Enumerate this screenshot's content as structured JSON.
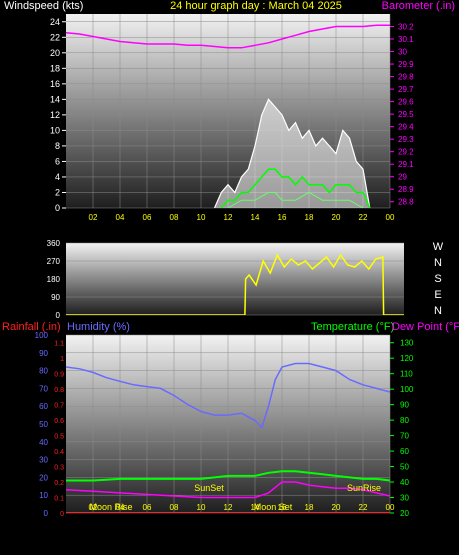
{
  "header": {
    "left_label": "Windspeed (kts)",
    "title": "24 hour graph day : March 04 2025",
    "right_label": "Barometer (.in)"
  },
  "bottom_header": {
    "rainfall_label": "Rainfall (.in)",
    "humidity_label": "Humidity (%)",
    "temperature_label": "Temperature (°F)",
    "dewpoint_label": "Dew Point (°F)"
  },
  "annotations": {
    "sunset": "SunSet",
    "sunrise": "SunRise",
    "moon_rise": "Moon Rise",
    "moon_set": "Moon Set"
  },
  "colors": {
    "white": "#ffffff",
    "yellow": "#ffff00",
    "magenta": "#ff00ff",
    "red": "#ff2020",
    "blue": "#6a6aff",
    "green": "#00ff00",
    "light_green": "#66ff66"
  },
  "chart_data": [
    {
      "id": "wind",
      "type": "line",
      "title": "24 hour graph day : March 04 2025",
      "x_ticks": [
        "02",
        "04",
        "06",
        "08",
        "10",
        "12",
        "14",
        "16",
        "18",
        "20",
        "22",
        "00"
      ],
      "x_range": [
        0,
        24
      ],
      "left_axis": {
        "label": "Windspeed (kts)",
        "ticks": [
          0,
          2,
          4,
          6,
          8,
          10,
          12,
          14,
          16,
          18,
          20,
          22,
          24
        ],
        "range": [
          0,
          25
        ]
      },
      "right_axis": {
        "label": "Barometer (.in)",
        "ticks": [
          28.8,
          28.9,
          29.0,
          29.1,
          29.2,
          29.3,
          29.4,
          29.5,
          29.6,
          29.7,
          29.8,
          29.9,
          30.0,
          30.1,
          30.2
        ],
        "tick_labels": [
          "28.8",
          "28.9",
          "29",
          "29.1",
          "29.2",
          "29.3",
          "29.4",
          "29.5",
          "29.6",
          "29.7",
          "29.8",
          "29.9",
          "30",
          "30.1",
          "30.2"
        ],
        "range": [
          28.75,
          30.3
        ]
      },
      "series": [
        {
          "kind": "barometer",
          "axis": "right",
          "x": [
            0,
            1,
            2,
            3,
            4,
            5,
            6,
            7,
            8,
            9,
            10,
            11,
            12,
            13,
            14,
            15,
            16,
            17,
            18,
            19,
            20,
            21,
            22,
            23,
            24
          ],
          "values": [
            30.15,
            30.14,
            30.12,
            30.1,
            30.08,
            30.07,
            30.06,
            30.06,
            30.06,
            30.05,
            30.05,
            30.04,
            30.03,
            30.03,
            30.05,
            30.07,
            30.1,
            30.13,
            30.16,
            30.18,
            30.2,
            30.2,
            30.2,
            30.21,
            30.21
          ]
        },
        {
          "kind": "gust",
          "axis": "left",
          "x": [
            11.0,
            11.5,
            12.0,
            12.5,
            13.0,
            13.5,
            14.0,
            14.5,
            15.0,
            15.5,
            16.0,
            16.5,
            17.0,
            17.5,
            18.0,
            18.5,
            19.0,
            19.5,
            20.0,
            20.5,
            21.0,
            21.5,
            22.0,
            22.5
          ],
          "values": [
            0,
            2,
            3,
            2,
            4,
            5,
            8,
            12,
            14,
            13,
            12,
            10,
            11,
            9,
            10,
            8,
            9,
            8,
            7,
            10,
            9,
            6,
            5,
            0
          ]
        },
        {
          "kind": "wind_avg",
          "axis": "left",
          "x": [
            11.5,
            12.0,
            12.5,
            13.0,
            13.5,
            14.0,
            14.5,
            15.0,
            15.5,
            16.0,
            16.5,
            17.0,
            17.5,
            18.0,
            18.5,
            19.0,
            19.5,
            20.0,
            20.5,
            21.0,
            21.5,
            22.0,
            22.5
          ],
          "values": [
            0,
            1,
            1,
            2,
            2,
            3,
            4,
            5,
            5,
            4,
            4,
            3,
            4,
            3,
            3,
            3,
            2,
            3,
            3,
            3,
            2,
            2,
            0
          ]
        },
        {
          "kind": "wind_min",
          "axis": "left",
          "x": [
            12.0,
            13.0,
            14.0,
            15.0,
            15.5,
            16.0,
            17.0,
            18.0,
            19.0,
            20.0,
            21.0,
            22.0
          ],
          "values": [
            0,
            1,
            1,
            2,
            2,
            1,
            1,
            2,
            1,
            1,
            1,
            0
          ]
        }
      ]
    },
    {
      "id": "direction",
      "type": "line",
      "x_range": [
        0,
        24
      ],
      "y_axis": {
        "ticks": [
          0,
          90,
          180,
          270,
          360
        ],
        "range": [
          0,
          360
        ]
      },
      "compass_labels": [
        "W",
        "N",
        "S",
        "E",
        "N"
      ],
      "series": [
        {
          "kind": "wind_direction",
          "x": [
            0,
            12.7,
            12.75,
            13.0,
            13.5,
            14.0,
            14.5,
            15.0,
            15.5,
            16.0,
            16.5,
            17.0,
            17.5,
            18.0,
            18.5,
            19.0,
            19.5,
            20.0,
            20.5,
            21.0,
            21.5,
            22.0,
            22.5,
            22.55,
            24
          ],
          "values": [
            0,
            0,
            180,
            200,
            150,
            270,
            210,
            300,
            240,
            280,
            250,
            270,
            230,
            260,
            290,
            240,
            300,
            250,
            240,
            270,
            230,
            280,
            290,
            0,
            0
          ]
        }
      ]
    },
    {
      "id": "climate",
      "type": "line",
      "x_range": [
        0,
        24
      ],
      "annotations": [
        "SunSet",
        "SunRise",
        "Moon Rise",
        "Moon Set"
      ],
      "rain_axis": {
        "label": "Rainfall (.in)",
        "ticks": [
          0,
          0.1,
          0.2,
          0.3,
          0.4,
          0.5,
          0.6,
          0.7,
          0.8,
          0.9,
          1.0,
          1.1
        ],
        "tick_labels": [
          "0",
          "0.1",
          "0.2",
          "0.3",
          "0.4",
          "0.5",
          "0.6",
          "0.7",
          "0.8",
          "0.9",
          "1",
          "1.1"
        ],
        "range": [
          0,
          1.15
        ]
      },
      "humidity_axis": {
        "label": "Humidity (%)",
        "ticks": [
          0,
          10,
          20,
          30,
          40,
          50,
          60,
          70,
          80,
          90,
          100
        ],
        "range": [
          0,
          100
        ]
      },
      "temperature_axis": {
        "label": "Temperature (°F)",
        "ticks": [
          20,
          30,
          40,
          50,
          60,
          70,
          80,
          90,
          100,
          110,
          120,
          130
        ],
        "range": [
          20,
          135
        ]
      },
      "series": [
        {
          "kind": "humidity",
          "x": [
            0,
            1,
            2,
            3,
            4,
            5,
            6,
            7,
            8,
            9,
            10,
            11,
            12,
            13,
            14,
            14.5,
            15,
            15.5,
            16,
            17,
            18,
            19,
            20,
            21,
            22,
            23,
            24
          ],
          "values": [
            82,
            81,
            79,
            76,
            74,
            72,
            71,
            70,
            66,
            61,
            57,
            55,
            55,
            56,
            52,
            48,
            60,
            75,
            82,
            84,
            84,
            82,
            80,
            75,
            72,
            70,
            68
          ]
        },
        {
          "kind": "temperature",
          "x": [
            0,
            2,
            4,
            6,
            8,
            10,
            11,
            12,
            13,
            14,
            15,
            16,
            17,
            18,
            19,
            20,
            21,
            22,
            23,
            24
          ],
          "values": [
            41,
            41,
            42,
            42,
            42,
            42,
            43,
            44,
            44,
            44,
            46,
            47,
            47,
            46,
            45,
            44,
            43,
            42,
            42,
            41
          ]
        },
        {
          "kind": "dew_point",
          "x": [
            0,
            2,
            4,
            6,
            8,
            10,
            12,
            13,
            14,
            15,
            16,
            17,
            18,
            19,
            20,
            21,
            22,
            23,
            24
          ],
          "values": [
            35,
            34,
            33,
            32,
            31,
            30,
            30,
            30,
            30,
            33,
            40,
            40,
            38,
            37,
            36,
            36,
            35,
            33,
            31
          ]
        },
        {
          "kind": "rainfall",
          "x": [
            0,
            24
          ],
          "values": [
            0,
            0
          ]
        }
      ]
    }
  ]
}
